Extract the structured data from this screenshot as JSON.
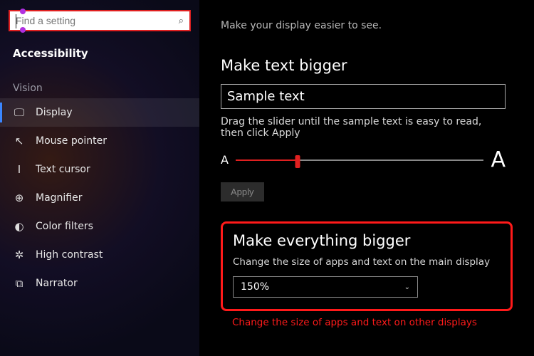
{
  "search": {
    "placeholder": "Find a setting"
  },
  "sidebar": {
    "title": "Accessibility",
    "group": "Vision",
    "items": [
      {
        "label": "Display",
        "icon": "🖵"
      },
      {
        "label": "Mouse pointer",
        "icon": "↖"
      },
      {
        "label": "Text cursor",
        "icon": "I"
      },
      {
        "label": "Magnifier",
        "icon": "⊕"
      },
      {
        "label": "Color filters",
        "icon": "◐"
      },
      {
        "label": "High contrast",
        "icon": "✲"
      },
      {
        "label": "Narrator",
        "icon": "⧉"
      }
    ]
  },
  "main": {
    "subtitle": "Make your display easier to see.",
    "text_bigger": {
      "heading": "Make text bigger",
      "sample": "Sample text",
      "hint": "Drag the slider until the sample text is easy to read, then click Apply",
      "small_a": "A",
      "big_a": "A",
      "apply": "Apply"
    },
    "everything_bigger": {
      "heading": "Make everything bigger",
      "desc": "Change the size of apps and text on the main display",
      "value": "150%"
    },
    "footer_link": "Change the size of apps and text on other displays"
  }
}
